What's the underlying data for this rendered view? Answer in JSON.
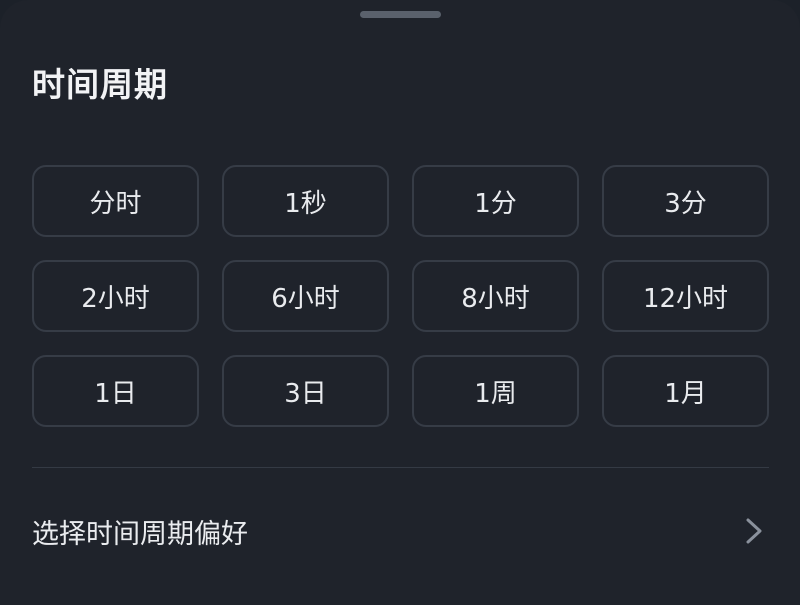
{
  "sheet": {
    "title": "时间周期"
  },
  "periods": [
    {
      "label": "分时"
    },
    {
      "label": "1秒"
    },
    {
      "label": "1分"
    },
    {
      "label": "3分"
    },
    {
      "label": "2小时"
    },
    {
      "label": "6小时"
    },
    {
      "label": "8小时"
    },
    {
      "label": "12小时"
    },
    {
      "label": "1日"
    },
    {
      "label": "3日"
    },
    {
      "label": "1周"
    },
    {
      "label": "1月"
    }
  ],
  "preference": {
    "label": "选择时间周期偏好",
    "icon": "chevron-right-icon"
  },
  "colors": {
    "background": "#1f232b",
    "border": "#363c46",
    "text": "#eaecef"
  }
}
